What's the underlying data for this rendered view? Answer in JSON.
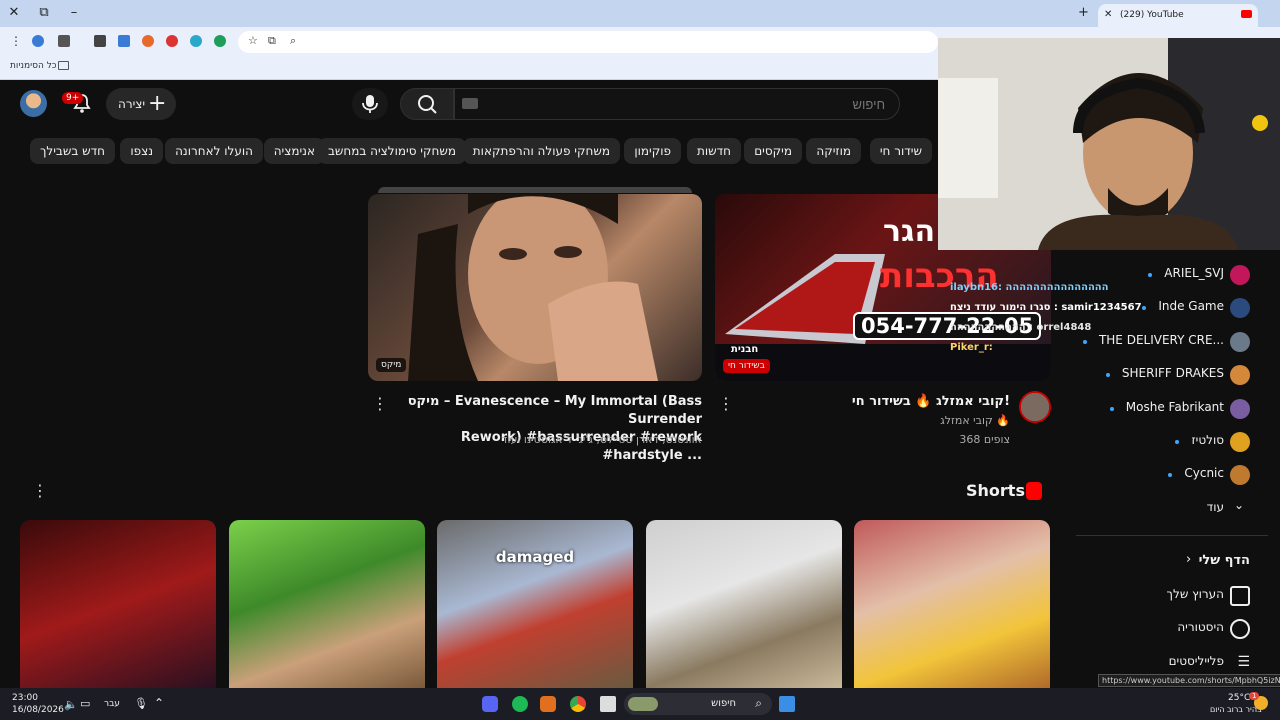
{
  "browser": {
    "tab_title": "(229) YouTube",
    "bookmarks_label": "כל הסימניות",
    "new_tab": "+",
    "close": "✕",
    "restore": "⧉",
    "minimize": "–",
    "tab_close": "✕"
  },
  "header": {
    "notif_badge": "9+",
    "create_label": "יצירה",
    "search_placeholder": "חיפוש"
  },
  "chips": [
    "שידור חי",
    "מוזיקה",
    "מיקסים",
    "חדשות",
    "פוקימון",
    "משחקי פעולה והרפתקאות",
    "משחקי סימולציה במחשב",
    "אנימציה",
    "הועלו לאחרונה",
    "נצפו",
    "חדש בשבילך"
  ],
  "videos": [
    {
      "title_line1": "מיקס – Evanescence – My Immortal (Bass Surrender",
      "title_line2": "Rework) #bassurrender #rework #hardstyle ...",
      "meta": "אוונסנס, דארן סטיילס, ג'יג' ד'אגוסטינו ועוד",
      "badge": "מיקס"
    },
    {
      "title": "קובי אמזלג 🔥 בשידור חי!",
      "channel": "קובי אמזלג 🔥",
      "viewers": "368 צופים",
      "badge": "בשידור חי",
      "thumb_phone": "054-777-22-05",
      "thumb_big": "הרכבות",
      "thumb_brand": "חבנית",
      "thumb_tag": "הגר"
    }
  ],
  "chat": {
    "lines": [
      "ilaybn16: ההההההההההההההה",
      "סגרו הימור עודד ניצח : samir1234567",
      "ההההההההההה : orrel4848",
      "Piker_r:"
    ]
  },
  "shorts": {
    "title": "Shorts",
    "items": [
      {
        "overlay": ""
      },
      {
        "overlay": ""
      },
      {
        "overlay": "damaged"
      },
      {
        "overlay": ""
      },
      {
        "overlay": ""
      }
    ]
  },
  "sidebar": {
    "subscriptions": [
      {
        "name": "ARIEL_SVJ",
        "color": "#c2185b"
      },
      {
        "name": "Inde Game",
        "color": "#2b4a7e"
      },
      {
        "name": "THE DELIVERY CRE...",
        "color": "#6b7a88"
      },
      {
        "name": "SHERIFF DRAKES",
        "color": "#d4893a"
      },
      {
        "name": "Moshe Fabrikant",
        "color": "#7a5ca0"
      },
      {
        "name": "סולטיז",
        "color": "#e0a020"
      },
      {
        "name": "Cycnic",
        "color": "#c07a30"
      }
    ],
    "more_label": "עוד",
    "you_label": "הדף שלי",
    "your_channel": "הערוץ שלך",
    "history": "היסטוריה",
    "playlists": "פלייליסטים"
  },
  "taskbar": {
    "time": "23:00",
    "date": "16/08/2026",
    "lang": "עבר",
    "search": "חיפוש",
    "temp": "25°C",
    "weather": "בהיר ברוב היום",
    "weather_badge": "1"
  },
  "status_url": "https://www.youtube.com/shorts/MpbhQ5izNAM"
}
